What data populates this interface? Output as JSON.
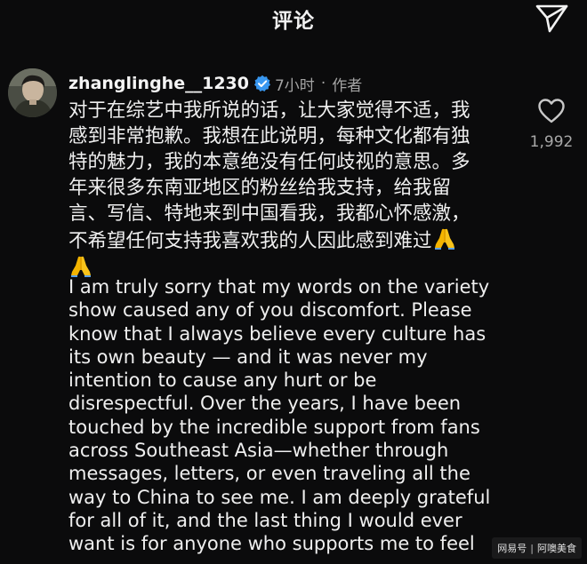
{
  "header": {
    "title": "评论",
    "send_icon": "paper-plane-icon"
  },
  "comment": {
    "username": "zhanglinghe__1230",
    "verified_icon": "verified-badge-icon",
    "verified_color": "#3897f0",
    "time": "7小时",
    "dot": "·",
    "author_tag": "作者",
    "text_cn_lines": [
      "对于在综艺中我所说的话，让大家觉得不适，我",
      "感到非常抱歉。我想在此说明，每种文化都有独",
      "特的魅力，我的本意绝没有任何歧视的意思。多",
      "年来很多东南亚地区的粉丝给我支持，给我留",
      "言、写信、特地来到中国看我，我都心怀感激，",
      "不希望任何支持我喜欢我的人因此感到难过"
    ],
    "emoji": "folded-hands-emoji",
    "text_en_lines": [
      "I am truly sorry that my words on the variety",
      "show caused any of you discomfort. Please",
      "know that I always believe every culture has",
      "its own beauty — and it was never my",
      "intention to cause any hurt or be",
      "disrespectful. Over the years, I have been",
      "touched by the incredible support from fans",
      "across Southeast Asia—whether through",
      "messages, letters, or even traveling all the",
      "way to China to see me. I am deeply grateful",
      "for all of it, and the last thing I would ever",
      "want is for anyone who supports me to feel"
    ],
    "like_icon": "heart-icon",
    "like_count": "1,992"
  },
  "watermark": {
    "left": "网易号",
    "sep": "|",
    "right": "阿噢美食"
  }
}
